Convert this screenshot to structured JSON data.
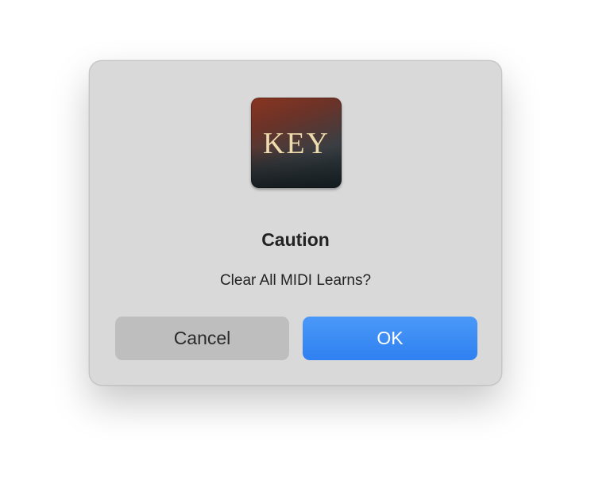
{
  "dialog": {
    "app_icon": {
      "name": "key-app-icon",
      "text": "KEY"
    },
    "title": "Caution",
    "message": "Clear All MIDI Learns?",
    "buttons": {
      "cancel_label": "Cancel",
      "ok_label": "OK"
    }
  },
  "colors": {
    "dialog_background": "#d9d9d9",
    "cancel_button": "#bebebe",
    "ok_button": "#3a8bf5",
    "icon_text": "#efdcae"
  }
}
